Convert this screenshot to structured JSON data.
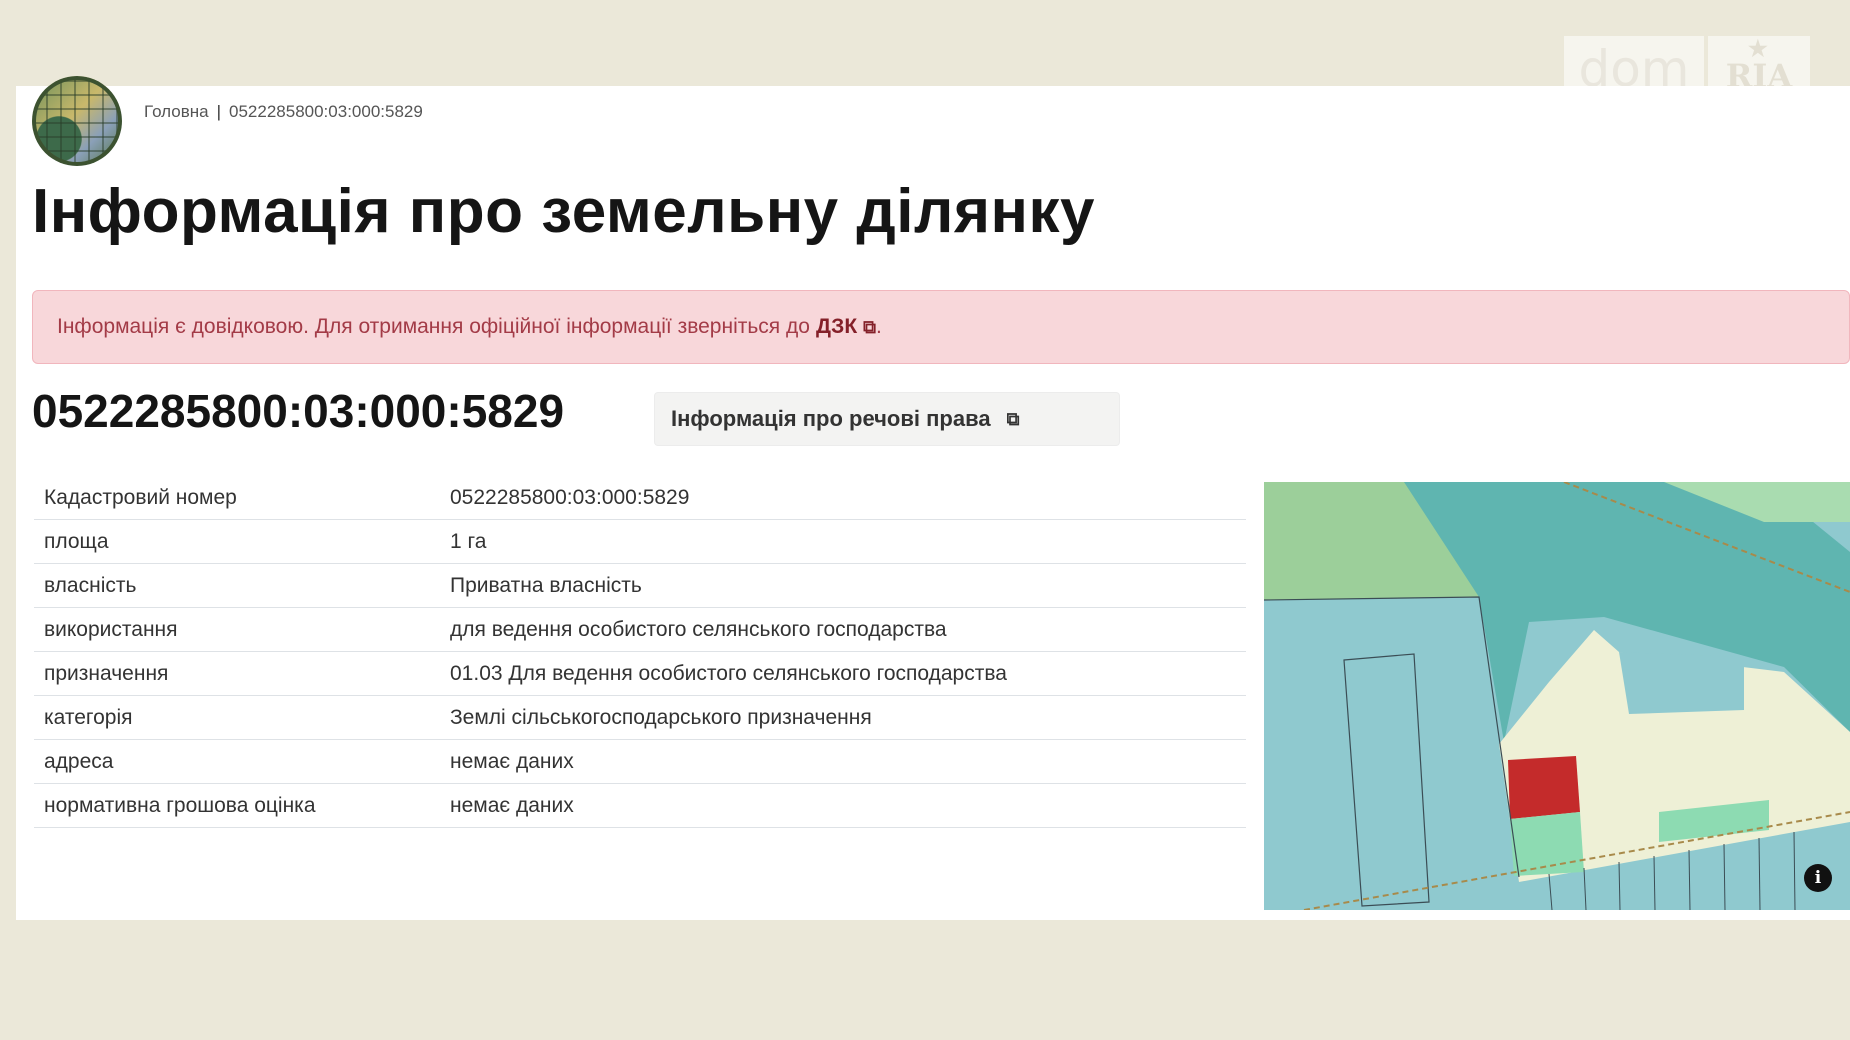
{
  "watermark": {
    "left": "dom",
    "right": "RIA"
  },
  "breadcrumb": {
    "home": "Головна",
    "separator": "|",
    "current": "0522285800:03:000:5829"
  },
  "title": "Інформація про земельну ділянку",
  "alert": {
    "text": "Інформація є довідковою. Для отримання офіційної інформації зверніться до",
    "link": "ДЗК",
    "suffix": "."
  },
  "parcel": {
    "number": "0522285800:03:000:5829",
    "rights_button": "Інформація про речові права"
  },
  "details": [
    {
      "label": "Кадастровий номер",
      "value": "0522285800:03:000:5829"
    },
    {
      "label": "площа",
      "value": "1 га"
    },
    {
      "label": "власність",
      "value": "Приватна власність"
    },
    {
      "label": "використання",
      "value": "для ведення особистого селянського господарства"
    },
    {
      "label": "призначення",
      "value": "01.03 Для ведення особистого селянського господарства"
    },
    {
      "label": "категорія",
      "value": "Землі сільськогосподарського призначення"
    },
    {
      "label": "адреса",
      "value": "немає даних"
    },
    {
      "label": "нормативна грошова оцінка",
      "value": "немає даних"
    }
  ],
  "map": {
    "info_icon": "info-icon",
    "colors": {
      "field_blue": "#8fc9cf",
      "forest_teal": "#5fb5b0",
      "meadow_green": "#9ccf9a",
      "cream": "#eef0d6",
      "highlight_parcel": "#c42b2b",
      "small_parcel": "#8ddbb2"
    }
  }
}
